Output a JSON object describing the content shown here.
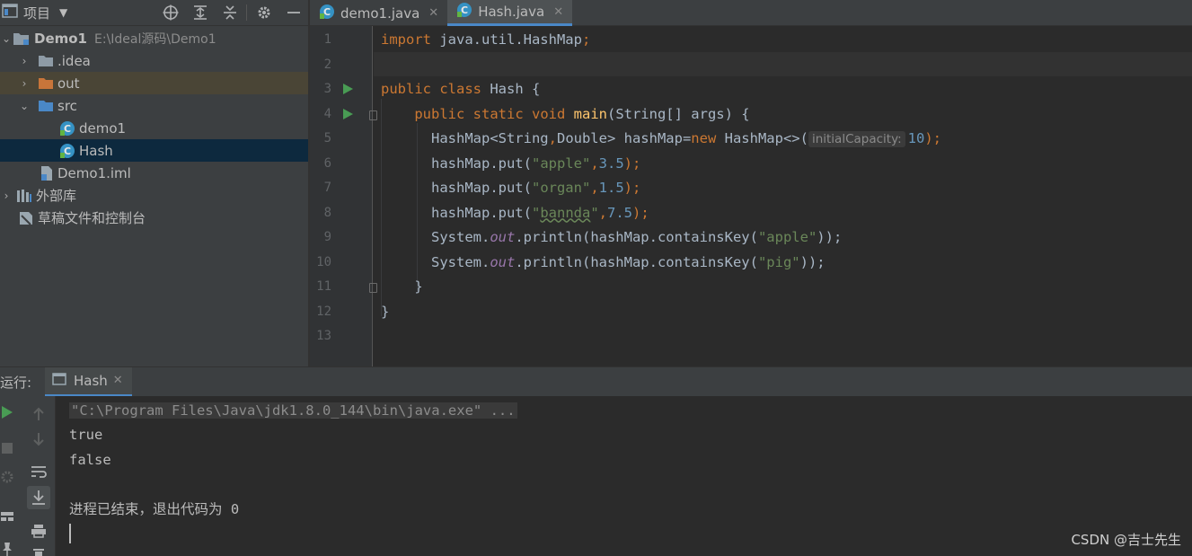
{
  "project_panel": {
    "title": "项目",
    "tree": [
      {
        "label": "Demo1",
        "path": "E:\\Ideal源码\\Demo1",
        "icon": "module-folder-icon"
      },
      {
        "label": ".idea",
        "icon": "folder-icon"
      },
      {
        "label": "out",
        "icon": "orange-folder-icon"
      },
      {
        "label": "src",
        "icon": "source-folder-icon"
      },
      {
        "label": "demo1",
        "icon": "java-class-icon"
      },
      {
        "label": "Hash",
        "icon": "java-class-icon"
      },
      {
        "label": "Demo1.iml",
        "icon": "iml-file-icon"
      },
      {
        "label": "外部库",
        "icon": "library-icon"
      },
      {
        "label": "草稿文件和控制台",
        "icon": "scratches-icon"
      }
    ]
  },
  "editor_tabs": [
    {
      "label": "demo1.java",
      "active": false
    },
    {
      "label": "Hash.java",
      "active": true
    }
  ],
  "editor": {
    "line_numbers": [
      "1",
      "2",
      "3",
      "4",
      "5",
      "6",
      "7",
      "8",
      "9",
      "10",
      "11",
      "12",
      "13"
    ],
    "code": [
      [
        {
          "t": "import ",
          "c": "kw"
        },
        {
          "t": "java.util.HashMap",
          "c": ""
        },
        {
          "t": ";",
          "c": "kw"
        }
      ],
      [],
      [
        {
          "t": "public ",
          "c": "kw"
        },
        {
          "t": "class ",
          "c": "kw"
        },
        {
          "t": "Hash {",
          "c": ""
        }
      ],
      [
        {
          "t": "    public ",
          "c": "kw"
        },
        {
          "t": "static ",
          "c": "kw"
        },
        {
          "t": "void ",
          "c": "kw"
        },
        {
          "t": "main",
          "c": "fn"
        },
        {
          "t": "(String[] args) {",
          "c": ""
        }
      ],
      [
        {
          "t": "      HashMap<String",
          "c": ""
        },
        {
          "t": ",",
          "c": "kw"
        },
        {
          "t": "Double> hashMap=",
          "c": ""
        },
        {
          "t": "new ",
          "c": "kw"
        },
        {
          "t": "HashMap<>(",
          "c": ""
        },
        {
          "t": "initialCapacity:",
          "c": "hint"
        },
        {
          "t": "10",
          "c": "num"
        },
        {
          "t": ");",
          "c": "kw"
        }
      ],
      [
        {
          "t": "      hashMap.put(",
          "c": ""
        },
        {
          "t": "\"apple\"",
          "c": "str"
        },
        {
          "t": ",",
          "c": "kw"
        },
        {
          "t": "3.5",
          "c": "num"
        },
        {
          "t": ");",
          "c": "kw"
        }
      ],
      [
        {
          "t": "      hashMap.put(",
          "c": ""
        },
        {
          "t": "\"organ\"",
          "c": "str"
        },
        {
          "t": ",",
          "c": "kw"
        },
        {
          "t": "1.5",
          "c": "num"
        },
        {
          "t": ");",
          "c": "kw"
        }
      ],
      [
        {
          "t": "      hashMap.put(",
          "c": ""
        },
        {
          "t": "\"",
          "c": "str"
        },
        {
          "t": "bannda",
          "c": "str typo"
        },
        {
          "t": "\"",
          "c": "str"
        },
        {
          "t": ",",
          "c": "kw"
        },
        {
          "t": "7.5",
          "c": "num"
        },
        {
          "t": ");",
          "c": "kw"
        }
      ],
      [
        {
          "t": "      System.",
          "c": ""
        },
        {
          "t": "out",
          "c": "fld"
        },
        {
          "t": ".println(hashMap.containsKey(",
          "c": ""
        },
        {
          "t": "\"apple\"",
          "c": "str"
        },
        {
          "t": "));",
          "c": ""
        }
      ],
      [
        {
          "t": "      System.",
          "c": ""
        },
        {
          "t": "out",
          "c": "fld"
        },
        {
          "t": ".println(hashMap.containsKey(",
          "c": ""
        },
        {
          "t": "\"pig\"",
          "c": "str"
        },
        {
          "t": "));",
          "c": ""
        }
      ],
      [
        {
          "t": "    }",
          "c": ""
        }
      ],
      [
        {
          "t": "}",
          "c": ""
        }
      ],
      []
    ]
  },
  "run_panel": {
    "label": "运行:",
    "tab": "Hash",
    "console": [
      "\"C:\\Program Files\\Java\\jdk1.8.0_144\\bin\\java.exe\" ...",
      "true",
      "false",
      "",
      "进程已结束，退出代码为 0"
    ],
    "watermark": "CSDN @吉士先生"
  },
  "colors": {
    "keyword": "#cc7832",
    "string": "#6a8759",
    "number": "#6897bb",
    "field": "#9876aa",
    "method": "#ffc66d",
    "accent": "#4a88c7",
    "run_green": "#499c54"
  }
}
